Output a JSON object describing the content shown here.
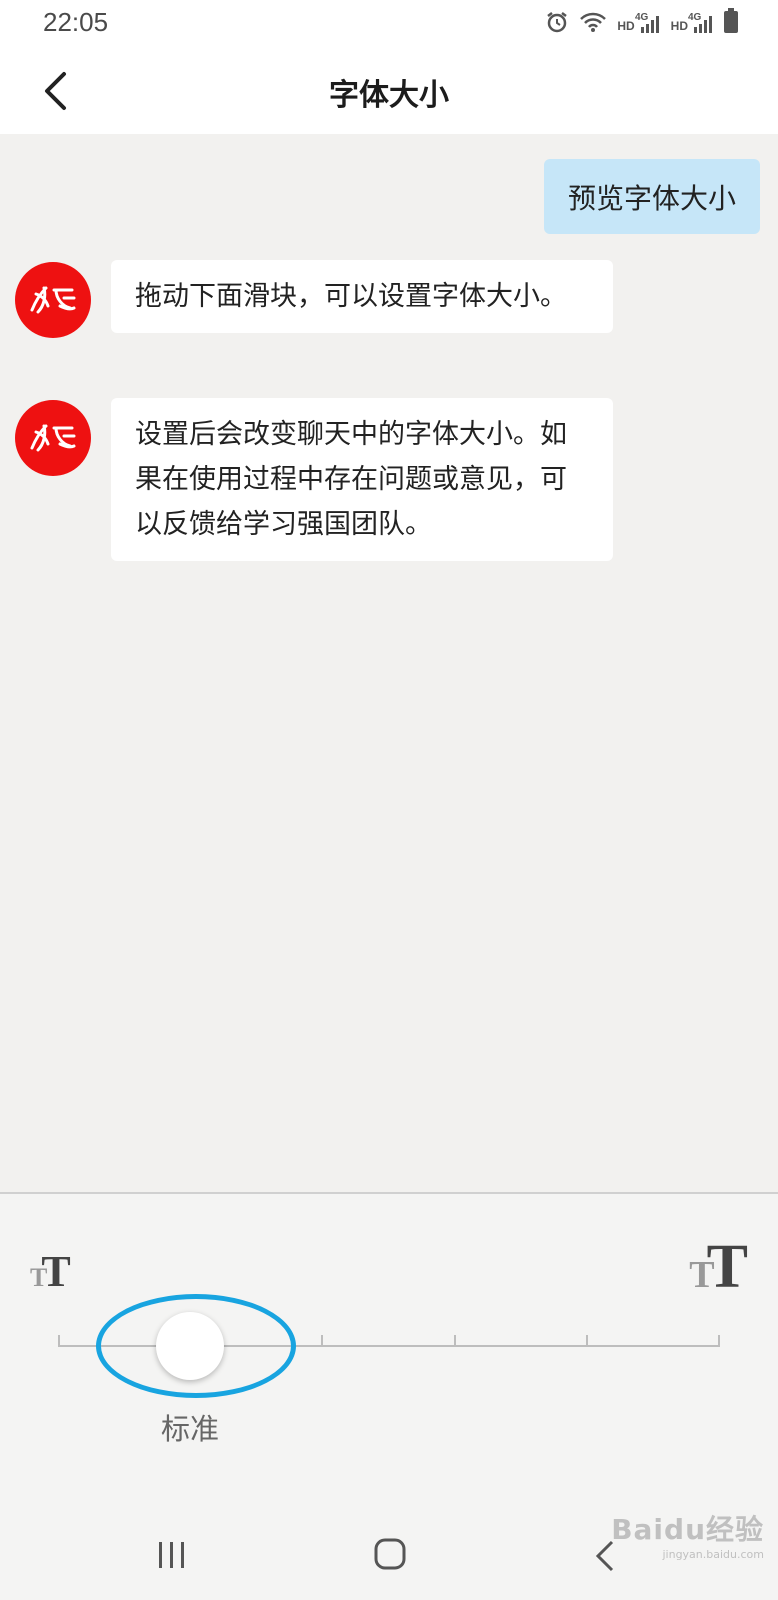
{
  "status_bar": {
    "time": "22:05",
    "icons": [
      "alarm-icon",
      "wifi-icon",
      "hd-4g-signal-icon",
      "hd-4g-signal-icon",
      "battery-icon"
    ],
    "network_label_1": "HD",
    "network_label_2": "HD",
    "network_type": "4G"
  },
  "header": {
    "back_icon": "chevron-left-icon",
    "title": "字体大小"
  },
  "chat": {
    "preview_message": "预览字体大小",
    "messages": [
      {
        "avatar": "xuexi-logo",
        "text": "拖动下面滑块，可以设置字体大小。"
      },
      {
        "avatar": "xuexi-logo",
        "text": "设置后会改变聊天中的字体大小。如果在使用过程中存在问题或意见，可以反馈给学习强国团队。"
      }
    ]
  },
  "font_slider": {
    "min_icon": "font-size-small-icon",
    "max_icon": "font-size-large-icon",
    "steps": 6,
    "selected_index": 1,
    "selected_label": "标准",
    "highlight_color": "#18a4e0"
  },
  "nav_bar": {
    "icons": [
      "recent-apps-icon",
      "home-icon",
      "back-icon"
    ]
  },
  "watermark": {
    "main": "Baidu经验",
    "sub": "jingyan.baidu.com"
  },
  "colors": {
    "avatar_red": "#ee1111",
    "preview_bubble": "#c6e6f8",
    "background": "#f2f1ef"
  }
}
